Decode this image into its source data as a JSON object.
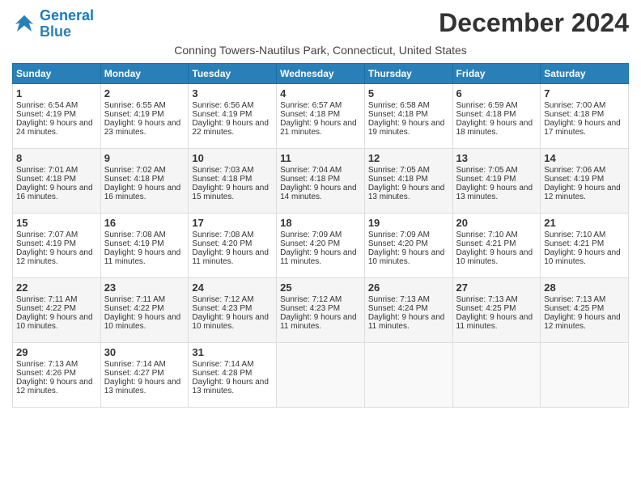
{
  "header": {
    "logo_line1": "General",
    "logo_line2": "Blue",
    "month_title": "December 2024",
    "subtitle": "Conning Towers-Nautilus Park, Connecticut, United States"
  },
  "weekdays": [
    "Sunday",
    "Monday",
    "Tuesday",
    "Wednesday",
    "Thursday",
    "Friday",
    "Saturday"
  ],
  "weeks": [
    [
      {
        "day": "1",
        "sunrise": "6:54 AM",
        "sunset": "4:19 PM",
        "daylight": "9 hours and 24 minutes."
      },
      {
        "day": "2",
        "sunrise": "6:55 AM",
        "sunset": "4:19 PM",
        "daylight": "9 hours and 23 minutes."
      },
      {
        "day": "3",
        "sunrise": "6:56 AM",
        "sunset": "4:19 PM",
        "daylight": "9 hours and 22 minutes."
      },
      {
        "day": "4",
        "sunrise": "6:57 AM",
        "sunset": "4:18 PM",
        "daylight": "9 hours and 21 minutes."
      },
      {
        "day": "5",
        "sunrise": "6:58 AM",
        "sunset": "4:18 PM",
        "daylight": "9 hours and 19 minutes."
      },
      {
        "day": "6",
        "sunrise": "6:59 AM",
        "sunset": "4:18 PM",
        "daylight": "9 hours and 18 minutes."
      },
      {
        "day": "7",
        "sunrise": "7:00 AM",
        "sunset": "4:18 PM",
        "daylight": "9 hours and 17 minutes."
      }
    ],
    [
      {
        "day": "8",
        "sunrise": "7:01 AM",
        "sunset": "4:18 PM",
        "daylight": "9 hours and 16 minutes."
      },
      {
        "day": "9",
        "sunrise": "7:02 AM",
        "sunset": "4:18 PM",
        "daylight": "9 hours and 16 minutes."
      },
      {
        "day": "10",
        "sunrise": "7:03 AM",
        "sunset": "4:18 PM",
        "daylight": "9 hours and 15 minutes."
      },
      {
        "day": "11",
        "sunrise": "7:04 AM",
        "sunset": "4:18 PM",
        "daylight": "9 hours and 14 minutes."
      },
      {
        "day": "12",
        "sunrise": "7:05 AM",
        "sunset": "4:18 PM",
        "daylight": "9 hours and 13 minutes."
      },
      {
        "day": "13",
        "sunrise": "7:05 AM",
        "sunset": "4:19 PM",
        "daylight": "9 hours and 13 minutes."
      },
      {
        "day": "14",
        "sunrise": "7:06 AM",
        "sunset": "4:19 PM",
        "daylight": "9 hours and 12 minutes."
      }
    ],
    [
      {
        "day": "15",
        "sunrise": "7:07 AM",
        "sunset": "4:19 PM",
        "daylight": "9 hours and 12 minutes."
      },
      {
        "day": "16",
        "sunrise": "7:08 AM",
        "sunset": "4:19 PM",
        "daylight": "9 hours and 11 minutes."
      },
      {
        "day": "17",
        "sunrise": "7:08 AM",
        "sunset": "4:20 PM",
        "daylight": "9 hours and 11 minutes."
      },
      {
        "day": "18",
        "sunrise": "7:09 AM",
        "sunset": "4:20 PM",
        "daylight": "9 hours and 11 minutes."
      },
      {
        "day": "19",
        "sunrise": "7:09 AM",
        "sunset": "4:20 PM",
        "daylight": "9 hours and 10 minutes."
      },
      {
        "day": "20",
        "sunrise": "7:10 AM",
        "sunset": "4:21 PM",
        "daylight": "9 hours and 10 minutes."
      },
      {
        "day": "21",
        "sunrise": "7:10 AM",
        "sunset": "4:21 PM",
        "daylight": "9 hours and 10 minutes."
      }
    ],
    [
      {
        "day": "22",
        "sunrise": "7:11 AM",
        "sunset": "4:22 PM",
        "daylight": "9 hours and 10 minutes."
      },
      {
        "day": "23",
        "sunrise": "7:11 AM",
        "sunset": "4:22 PM",
        "daylight": "9 hours and 10 minutes."
      },
      {
        "day": "24",
        "sunrise": "7:12 AM",
        "sunset": "4:23 PM",
        "daylight": "9 hours and 10 minutes."
      },
      {
        "day": "25",
        "sunrise": "7:12 AM",
        "sunset": "4:23 PM",
        "daylight": "9 hours and 11 minutes."
      },
      {
        "day": "26",
        "sunrise": "7:13 AM",
        "sunset": "4:24 PM",
        "daylight": "9 hours and 11 minutes."
      },
      {
        "day": "27",
        "sunrise": "7:13 AM",
        "sunset": "4:25 PM",
        "daylight": "9 hours and 11 minutes."
      },
      {
        "day": "28",
        "sunrise": "7:13 AM",
        "sunset": "4:25 PM",
        "daylight": "9 hours and 12 minutes."
      }
    ],
    [
      {
        "day": "29",
        "sunrise": "7:13 AM",
        "sunset": "4:26 PM",
        "daylight": "9 hours and 12 minutes."
      },
      {
        "day": "30",
        "sunrise": "7:14 AM",
        "sunset": "4:27 PM",
        "daylight": "9 hours and 13 minutes."
      },
      {
        "day": "31",
        "sunrise": "7:14 AM",
        "sunset": "4:28 PM",
        "daylight": "9 hours and 13 minutes."
      },
      null,
      null,
      null,
      null
    ]
  ]
}
